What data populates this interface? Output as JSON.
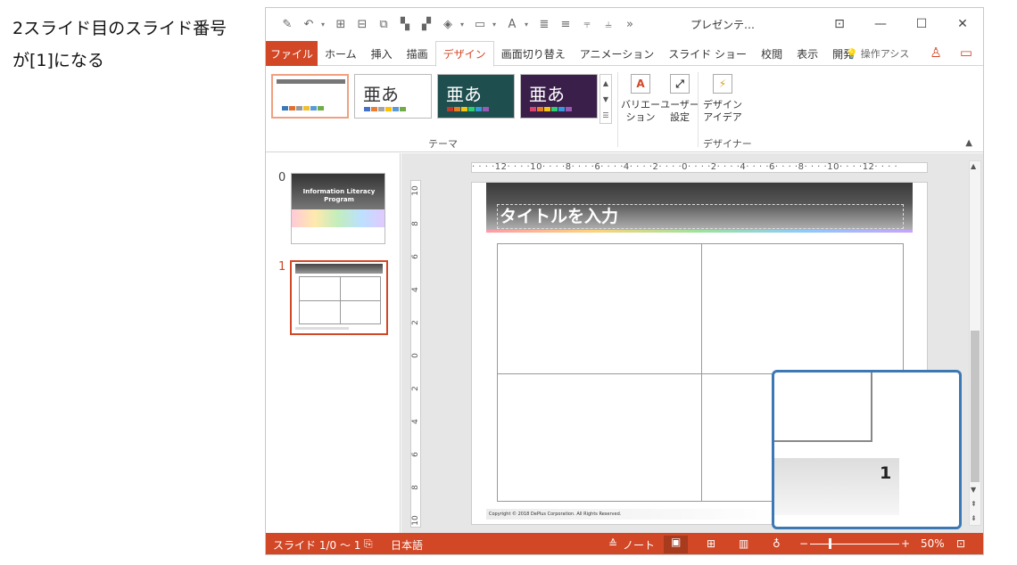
{
  "caption": {
    "line1": "2スライド目のスライド番号",
    "line2": "が[1]になる"
  },
  "window": {
    "doc_title": "プレゼンテ…"
  },
  "tabs": [
    "ファイル",
    "ホーム",
    "挿入",
    "描画",
    "デザイン",
    "画面切り替え",
    "アニメーション",
    "スライド ショー",
    "校閲",
    "表示",
    "開発"
  ],
  "tell_me": "操作アシス",
  "ribbon": {
    "theme_sample": "亜あ",
    "themes_label": "テーマ",
    "variation_label": "バリエーション",
    "custom_size_label": "ユーザー設定",
    "design_ideas_label": "デザイン アイデア",
    "designer_label": "デザイナー"
  },
  "thumbnails": [
    {
      "number": "0",
      "title": "Information Literacy Program"
    },
    {
      "number": "1"
    }
  ],
  "hruler_text": "· · · ·12· · · ·10· · · ·8· · · ·6· · · ·4· · · ·2· · · ·0· · · ·2· · · ·4· · · ·6· · · ·8· · · ·10· · · ·12· · · ·",
  "vruler_ticks": [
    "10",
    "8",
    "6",
    "4",
    "2",
    "0",
    "2",
    "4",
    "6",
    "8",
    "10"
  ],
  "slide": {
    "title_placeholder": "タイトルを入力",
    "footer": "Copyright © 2018 DePlus Corporation. All Rights Reserved."
  },
  "callout": {
    "slide_number": "1"
  },
  "statusbar": {
    "slide_info": "スライド 1/0 ～ 1",
    "language": "日本語",
    "notes": "ノート",
    "zoom": "50%"
  },
  "colors": {
    "accent": "#d24726",
    "callout_border": "#3c78b4"
  }
}
